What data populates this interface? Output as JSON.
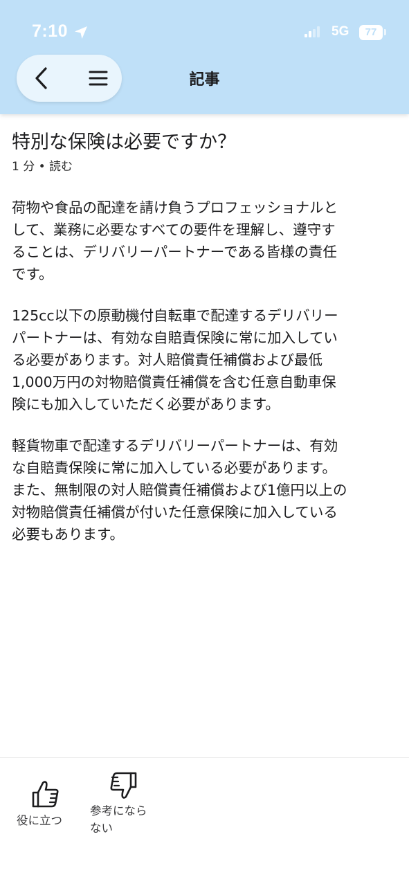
{
  "status_bar": {
    "time": "7:10",
    "network": "5G",
    "battery": "77"
  },
  "nav": {
    "title": "記事"
  },
  "article": {
    "title": "特別な保険は必要ですか？",
    "read_time": "1 分 • 読む",
    "paragraphs": [
      "荷物や食品の配達を請け負うプロフェッショナルと\nして、業務に必要なすべての要件を理解し、遵守す\nることは、デリバリーパートナーである皆様の責任\nです。",
      "125cc以下の原動機付自転車で配達するデリバリー\nパートナーは、有効な自賠責保険に常に加入してい\nる必要があります。対人賠償責任補償および最低\n1,000万円の対物賠償責任補償を含む任意自動車保\n険にも加入していただく必要があります。",
      "軽貨物車で配達するデリバリーパートナーは、有効\nな自賠責保険に常に加入している必要があります。\nまた、無制限の対人賠償責任補償および1億円以上の\n対物賠償責任補償が付いた任意保険に加入している\n必要もあります。"
    ]
  },
  "feedback": {
    "helpful_label": "役に立つ",
    "not_helpful_label": "参考になら\nない"
  }
}
